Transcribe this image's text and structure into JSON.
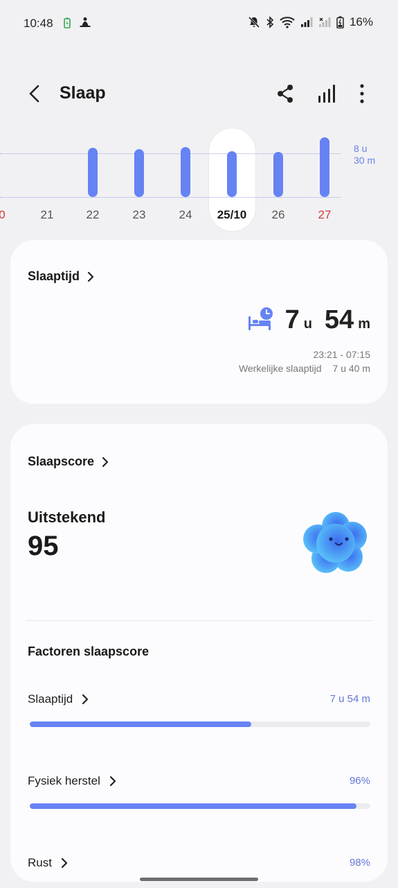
{
  "status_bar": {
    "time": "10:48",
    "battery": "16%"
  },
  "header": {
    "title": "Slaap"
  },
  "day_chart": {
    "reference_line": "8 u\n30 m",
    "days": [
      {
        "label": "0",
        "red": true,
        "selected": false,
        "value": null
      },
      {
        "label": "21",
        "red": false,
        "selected": false,
        "value": null
      },
      {
        "label": "22",
        "red": false,
        "selected": false,
        "value": 7.6
      },
      {
        "label": "23",
        "red": false,
        "selected": false,
        "value": 7.4
      },
      {
        "label": "24",
        "red": false,
        "selected": false,
        "value": 7.7
      },
      {
        "label": "25/10",
        "red": false,
        "selected": true,
        "value": 7.1
      },
      {
        "label": "26",
        "red": false,
        "selected": false,
        "value": 7.0
      },
      {
        "label": "27",
        "red": true,
        "selected": false,
        "value": 9.3
      }
    ]
  },
  "sleeptime_card": {
    "heading": "Slaaptijd",
    "hours": "7",
    "hours_unit": "u",
    "minutes": "54",
    "minutes_unit": "m",
    "time_range": "23:21 - 07:15",
    "actual_label": "Werkelijke slaaptijd",
    "actual_value": "7 u 40 m"
  },
  "score_card": {
    "heading": "Slaapscore",
    "rating": "Uitstekend",
    "score": "95",
    "factors_title": "Factoren slaapscore",
    "factors": [
      {
        "name": "Slaaptijd",
        "value": "7 u 54 m",
        "fill": 0.65
      },
      {
        "name": "Fysiek herstel",
        "value": "96%",
        "fill": 0.96
      },
      {
        "name": "Rust",
        "value": "98%",
        "fill": 0.98
      }
    ]
  },
  "colors": {
    "accent": "#6683f4",
    "weekend_red": "#d23a3a",
    "background": "#f1f1f3"
  }
}
